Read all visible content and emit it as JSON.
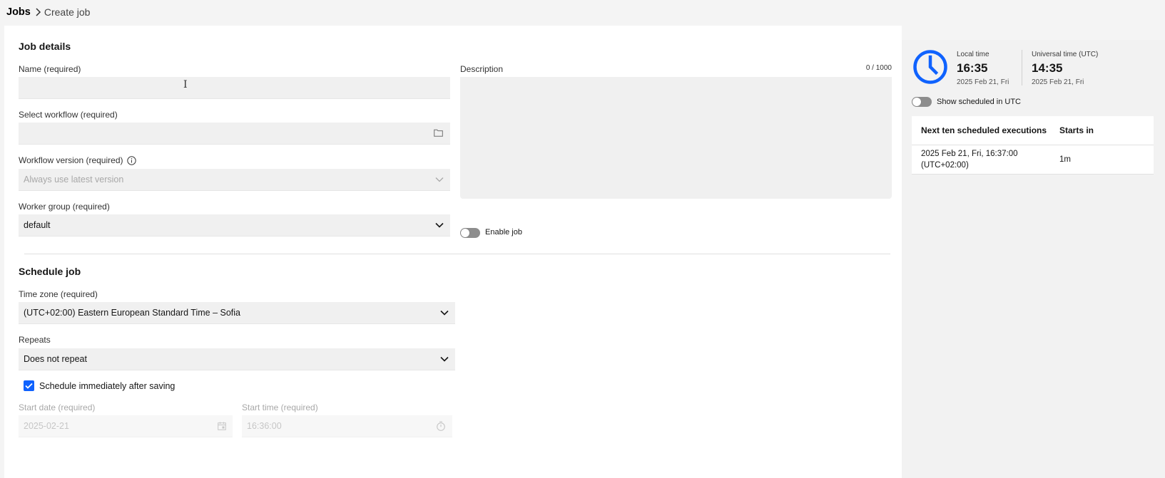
{
  "breadcrumb": {
    "root": "Jobs",
    "current": "Create job"
  },
  "job_details": {
    "title": "Job details",
    "name": {
      "label": "Name (required)",
      "value": ""
    },
    "workflow": {
      "label": "Select workflow (required)",
      "value": ""
    },
    "workflow_version": {
      "label": "Workflow version (required)",
      "value": "Always use latest version"
    },
    "worker_group": {
      "label": "Worker group (required)",
      "value": "default"
    },
    "description": {
      "label": "Description",
      "counter": "0 / 1000",
      "value": ""
    },
    "enable_job": {
      "label": "Enable job",
      "on": false
    }
  },
  "schedule": {
    "title": "Schedule job",
    "time_zone": {
      "label": "Time zone (required)",
      "value": "(UTC+02:00) Eastern European Standard Time – Sofia"
    },
    "repeats": {
      "label": "Repeats",
      "value": "Does not repeat"
    },
    "immediately": {
      "label": "Schedule immediately after saving",
      "checked": true
    },
    "start_date": {
      "label": "Start date (required)",
      "value": "2025-02-21"
    },
    "start_time": {
      "label": "Start time (required)",
      "value": "16:36:00"
    }
  },
  "side_panel": {
    "local": {
      "caption": "Local time",
      "time": "16:35",
      "date": "2025 Feb 21, Fri"
    },
    "utc": {
      "caption": "Universal time (UTC)",
      "time": "14:35",
      "date": "2025 Feb 21, Fri"
    },
    "show_utc": {
      "label": "Show scheduled in UTC",
      "on": false
    },
    "table": {
      "headers": [
        "Next ten scheduled executions",
        "Starts in"
      ],
      "rows": [
        {
          "when": "2025 Feb 21, Fri, 16:37:00 (UTC+02:00)",
          "starts_in": "1m"
        }
      ]
    }
  },
  "colors": {
    "accent": "#0f62fe",
    "clock": "#0f62fe"
  },
  "icons": [
    "chevron-right-icon",
    "info-icon",
    "folder-icon",
    "chevron-down-icon",
    "calendar-icon",
    "timer-icon",
    "clock-icon",
    "checkmark-icon"
  ]
}
